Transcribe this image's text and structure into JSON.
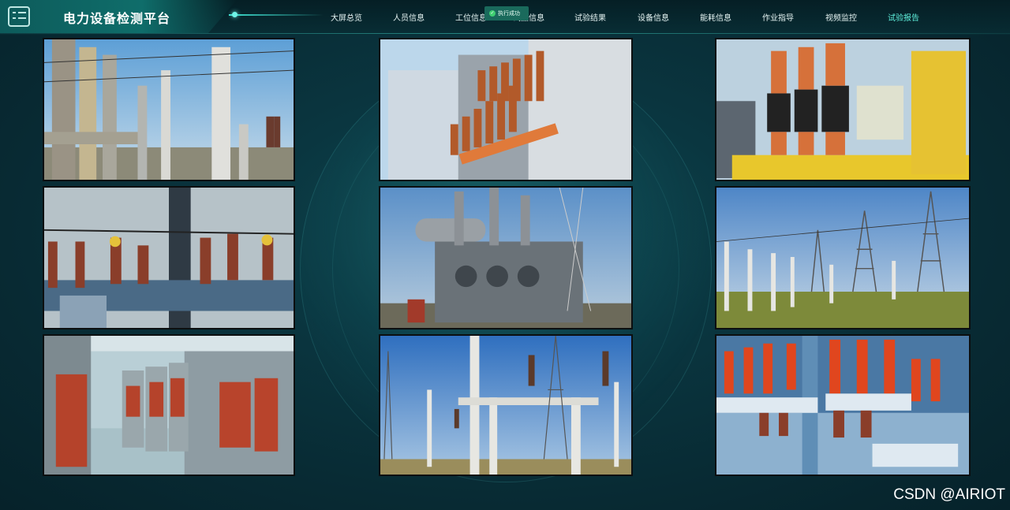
{
  "header": {
    "title": "电力设备检测平台",
    "logo_icon": "checklist-icon"
  },
  "nav": {
    "items": [
      {
        "label": "大屏总览"
      },
      {
        "label": "人员信息"
      },
      {
        "label": "工位信息"
      },
      {
        "label": "试品信息"
      },
      {
        "label": "试验结果"
      },
      {
        "label": "设备信息"
      },
      {
        "label": "能耗信息"
      },
      {
        "label": "作业指导"
      },
      {
        "label": "视频监控"
      },
      {
        "label": "试验报告"
      }
    ],
    "active_index": 9,
    "active_color": "#5ff0dd"
  },
  "toast": {
    "text": "执行成功",
    "icon": "check-circle-icon"
  },
  "video_grid": {
    "tiles": [
      {
        "scene": "substation-insulators-sky"
      },
      {
        "scene": "transformer-bushings-closeup"
      },
      {
        "scene": "yellow-transformer-bushings"
      },
      {
        "scene": "pole-mounted-switchgear"
      },
      {
        "scene": "large-power-transformer"
      },
      {
        "scene": "substation-field-towers"
      },
      {
        "scene": "indoor-switchgear-cabinets"
      },
      {
        "scene": "substation-structures-blue-sky"
      },
      {
        "scene": "glowing-insulator-array"
      }
    ]
  },
  "watermark": "CSDN @AIRIOT"
}
